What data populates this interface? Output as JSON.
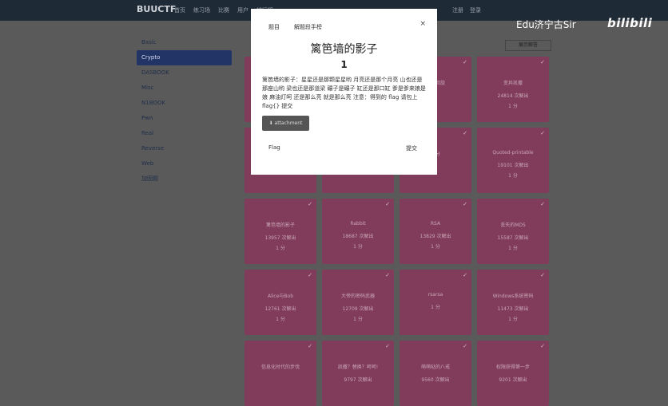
{
  "navbar": {
    "brand": "BUUCTF",
    "links": [
      "首页",
      "练习场",
      "比赛",
      "用户",
      "排行榜"
    ],
    "right_links": [
      "注册",
      "登录"
    ]
  },
  "watermark": {
    "text": "Edu济宁古Sir",
    "logo": "bilibili"
  },
  "sidebar": {
    "items": [
      "Basic",
      "Crypto",
      "DASBOOK",
      "Misc",
      "N1BOOK",
      "Pwn",
      "Real",
      "Reverse",
      "Web",
      "加固题"
    ],
    "active_index": 1
  },
  "toolbar": {
    "sort_label": "展示解答"
  },
  "challenges": [
    {
      "title": "",
      "stat": "",
      "points": "",
      "solved": true
    },
    {
      "title": "",
      "stat": "",
      "points": "",
      "solved": true
    },
    {
      "title": "看我回旋",
      "stat": "",
      "points": "",
      "solved": true
    },
    {
      "title": "变异凯撒",
      "stat": "24814 次解出",
      "points": "1 分",
      "solved": true
    },
    {
      "title": "",
      "stat": "",
      "points": "",
      "solved": true
    },
    {
      "title": "",
      "stat": "",
      "points": "",
      "solved": true
    },
    {
      "title": "",
      "stat": "",
      "points": "1 分",
      "solved": true
    },
    {
      "title": "Quoted-printable",
      "stat": "19101 次解出",
      "points": "1 分",
      "solved": true
    },
    {
      "title": "篱笆墙的影子",
      "stat": "13957 次解出",
      "points": "1 分",
      "solved": true
    },
    {
      "title": "Rabbit",
      "stat": "18687 次解出",
      "points": "1 分",
      "solved": true
    },
    {
      "title": "RSA",
      "stat": "13829 次解出",
      "points": "1 分",
      "solved": true
    },
    {
      "title": "丢失的MD5",
      "stat": "15587 次解出",
      "points": "1 分",
      "solved": true
    },
    {
      "title": "Alice与Bob",
      "stat": "12761 次解出",
      "points": "1 分",
      "solved": true
    },
    {
      "title": "大帝的密码武器",
      "stat": "12709 次解出",
      "points": "1 分",
      "solved": true
    },
    {
      "title": "rsarsa",
      "stat": "",
      "points": "1 分",
      "solved": true
    },
    {
      "title": "Windows系统密码",
      "stat": "11473 次解出",
      "points": "1 分",
      "solved": true
    },
    {
      "title": "信息化时代的步伐",
      "stat": "",
      "points": "",
      "solved": true
    },
    {
      "title": "凯撒？替换？呵呵!",
      "stat": "9797 次解出",
      "points": "",
      "solved": true
    },
    {
      "title": "萌萌哒的八戒",
      "stat": "9560 次解出",
      "points": "",
      "solved": true
    },
    {
      "title": "权限获得第一步",
      "stat": "9201 次解出",
      "points": "",
      "solved": true
    }
  ],
  "modal": {
    "tabs": [
      "题目",
      "解题段手榜"
    ],
    "close": "×",
    "title": "篱笆墙的影子",
    "points": "1",
    "description": "篱笆墙的影子：星星还是那颗星星哟 月亮还是那个月亮 山也还是那座山哟 梁也还是那道梁 碾子是碾子 缸还是那口缸 爹是爹来娘是娘 麻油灯呵 还是那么亮 就是那么亮 注意：得到的 flag 请包上 flag{} 提交",
    "download": "attachment",
    "flag_label": "Flag",
    "submit_label": "提交"
  }
}
